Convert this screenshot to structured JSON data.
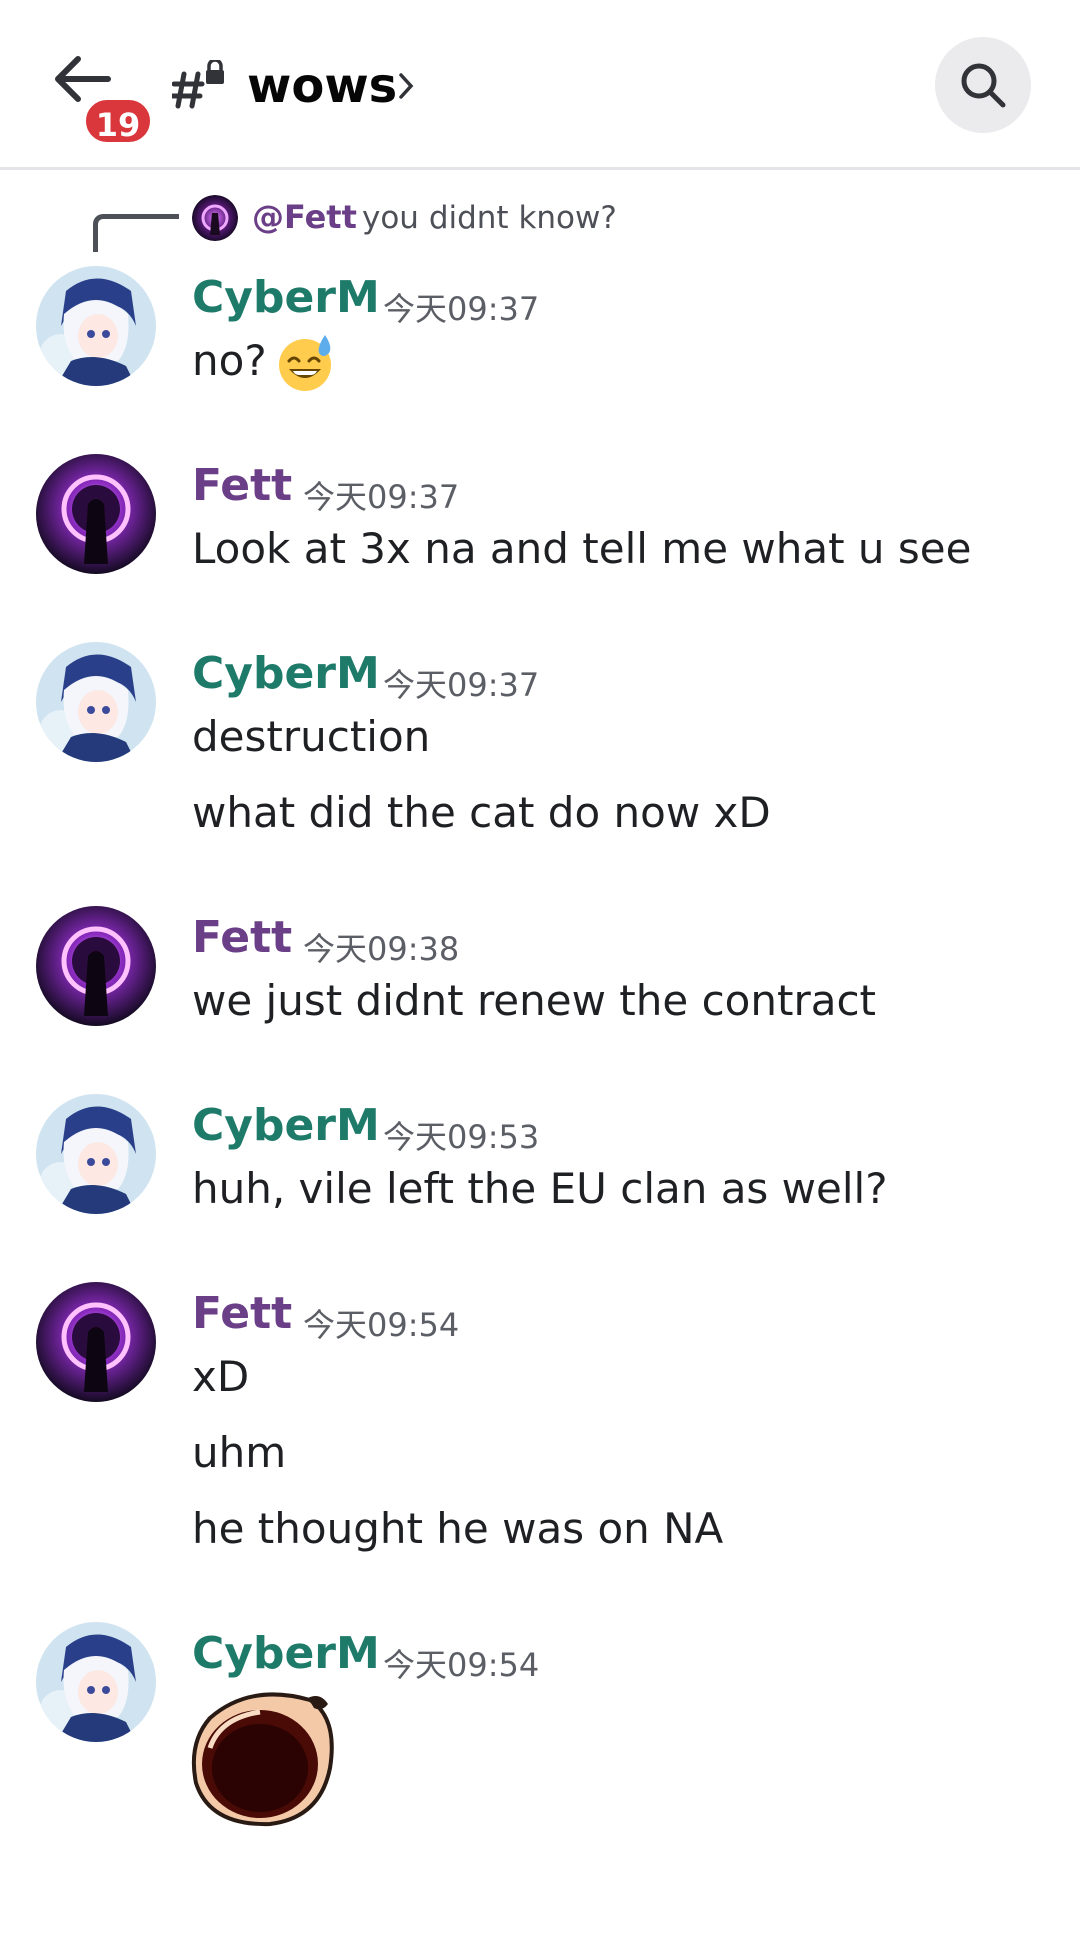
{
  "header": {
    "unread_count": "19",
    "channel_name": "wows"
  },
  "reply": {
    "mention": "@Fett",
    "text": "you didnt know?"
  },
  "messages": [
    {
      "author": "CyberM",
      "time": "今天09:37",
      "lines": [
        "no?"
      ],
      "emoji": "sweat-smile-emoji"
    },
    {
      "author": "Fett",
      "time": "今天09:37",
      "lines": [
        "Look at 3x na and tell me what u see"
      ]
    },
    {
      "author": "CyberM",
      "time": "今天09:37",
      "lines": [
        "destruction",
        "what did the cat do now xD"
      ]
    },
    {
      "author": "Fett",
      "time": "今天09:38",
      "lines": [
        "we just didnt renew the contract"
      ]
    },
    {
      "author": "CyberM",
      "time": "今天09:53",
      "lines": [
        "huh, vile left the EU clan as well?"
      ]
    },
    {
      "author": "Fett",
      "time": "今天09:54",
      "lines": [
        "xD",
        "uhm",
        "he thought he was on NA"
      ]
    },
    {
      "author": "CyberM",
      "time": "今天09:54",
      "lines": [],
      "sticker": "screaming-mouth-sticker"
    }
  ],
  "colors": {
    "cyber_name": "#1e7a69",
    "fett_name": "#6a3f87",
    "badge": "#da373c"
  }
}
